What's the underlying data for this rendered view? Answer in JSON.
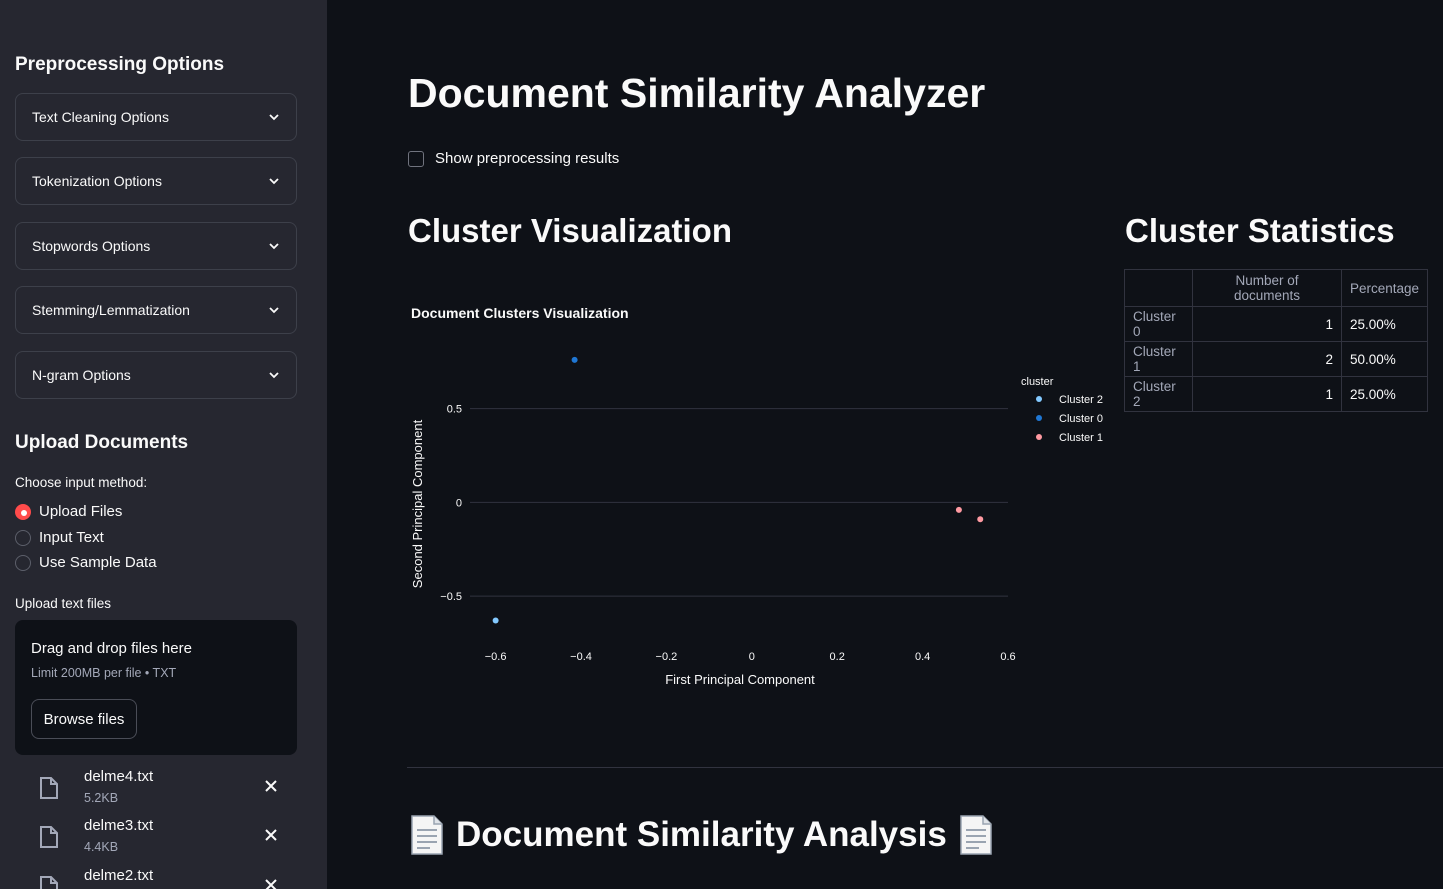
{
  "sidebar": {
    "preprocessing_title": "Preprocessing Options",
    "expanders": [
      {
        "label": "Text Cleaning Options"
      },
      {
        "label": "Tokenization Options"
      },
      {
        "label": "Stopwords Options"
      },
      {
        "label": "Stemming/Lemmatization"
      },
      {
        "label": "N-gram Options"
      }
    ],
    "upload_title": "Upload Documents",
    "input_method_label": "Choose input method:",
    "radio_options": [
      {
        "label": "Upload Files",
        "checked": true
      },
      {
        "label": "Input Text",
        "checked": false
      },
      {
        "label": "Use Sample Data",
        "checked": false
      }
    ],
    "upload_label": "Upload text files",
    "dropzone": {
      "title": "Drag and drop files here",
      "subtitle": "Limit 200MB per file • TXT",
      "browse_label": "Browse files"
    },
    "files": [
      {
        "name": "delme4.txt",
        "size": "5.2KB"
      },
      {
        "name": "delme3.txt",
        "size": "4.4KB"
      },
      {
        "name": "delme2.txt",
        "size": ""
      }
    ]
  },
  "main": {
    "title": "Document Similarity Analyzer",
    "show_preprocessing_label": "Show preprocessing results",
    "cluster_viz_title": "Cluster Visualization",
    "cluster_stats_title": "Cluster Statistics",
    "analysis_title": "Document Similarity Analysis",
    "stats_table": {
      "columns": [
        "",
        "Number of documents",
        "Percentage"
      ],
      "rows": [
        {
          "index": "Cluster 0",
          "count": "1",
          "pct": "25.00%"
        },
        {
          "index": "Cluster 1",
          "count": "2",
          "pct": "50.00%"
        },
        {
          "index": "Cluster 2",
          "count": "1",
          "pct": "25.00%"
        }
      ]
    }
  },
  "colors": {
    "accent": "#ff4b4b",
    "cluster_0": "#1f77d4",
    "cluster_1": "#ff9aa2",
    "cluster_2": "#83c9ff"
  },
  "chart_data": {
    "type": "scatter",
    "title": "Document Clusters Visualization",
    "xlabel": "First Principal Component",
    "ylabel": "Second Principal Component",
    "xlim": [
      -0.66,
      0.6
    ],
    "ylim": [
      -0.75,
      0.85
    ],
    "x_ticks": [
      -0.6,
      -0.4,
      -0.2,
      0,
      0.2,
      0.4,
      0.6
    ],
    "x_tick_labels": [
      "−0.6",
      "−0.4",
      "−0.2",
      "0",
      "0.2",
      "0.4",
      "0.6"
    ],
    "y_ticks": [
      0.5,
      0,
      -0.5
    ],
    "y_tick_labels": [
      "0.5",
      "0",
      "−0.5"
    ],
    "grid": "horizontal",
    "legend_title": "cluster",
    "legend_position": "right",
    "series": [
      {
        "name": "Cluster 2",
        "color": "#83c9ff",
        "points": [
          {
            "x": -0.6,
            "y": -0.63
          }
        ]
      },
      {
        "name": "Cluster 0",
        "color": "#1f77d4",
        "points": [
          {
            "x": -0.415,
            "y": 0.76
          }
        ]
      },
      {
        "name": "Cluster 1",
        "color": "#ff9aa2",
        "points": [
          {
            "x": 0.485,
            "y": -0.04
          },
          {
            "x": 0.535,
            "y": -0.09
          }
        ]
      }
    ]
  }
}
